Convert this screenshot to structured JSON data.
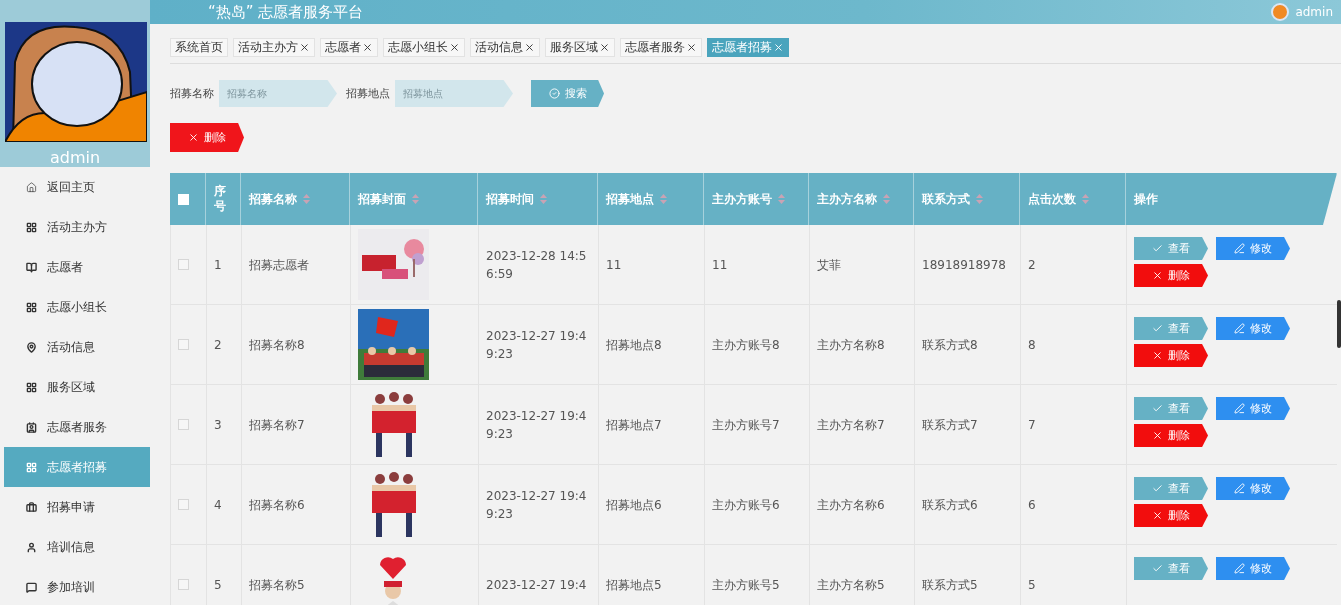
{
  "header": {
    "title": "“热岛” 志愿者服务平台",
    "user": "admin"
  },
  "sidebar": {
    "user": "admin",
    "items": [
      {
        "label": "返回主页",
        "selected": false
      },
      {
        "label": "活动主办方",
        "selected": false
      },
      {
        "label": "志愿者",
        "selected": false
      },
      {
        "label": "志愿小组长",
        "selected": false
      },
      {
        "label": "活动信息",
        "selected": false
      },
      {
        "label": "服务区域",
        "selected": false
      },
      {
        "label": "志愿者服务",
        "selected": false
      },
      {
        "label": "志愿者招募",
        "selected": true
      },
      {
        "label": "招募申请",
        "selected": false
      },
      {
        "label": "培训信息",
        "selected": false
      },
      {
        "label": "参加培训",
        "selected": false
      }
    ]
  },
  "tabs": [
    {
      "label": "系统首页",
      "closable": false,
      "selected": false
    },
    {
      "label": "活动主办方",
      "closable": true,
      "selected": false
    },
    {
      "label": "志愿者",
      "closable": true,
      "selected": false
    },
    {
      "label": "志愿小组长",
      "closable": true,
      "selected": false
    },
    {
      "label": "活动信息",
      "closable": true,
      "selected": false
    },
    {
      "label": "服务区域",
      "closable": true,
      "selected": false
    },
    {
      "label": "志愿者服务",
      "closable": true,
      "selected": false
    },
    {
      "label": "志愿者招募",
      "closable": true,
      "selected": true
    }
  ],
  "search": {
    "fields": [
      {
        "label": "招募名称",
        "placeholder": "招募名称"
      },
      {
        "label": "招募地点",
        "placeholder": "招募地点"
      }
    ],
    "button": "搜索"
  },
  "delete_button": "删除",
  "table": {
    "all_checked": false,
    "columns": [
      {
        "label": "序号",
        "sortable": false
      },
      {
        "label": "招募名称",
        "sortable": true
      },
      {
        "label": "招募封面",
        "sortable": true
      },
      {
        "label": "招募时间",
        "sortable": true
      },
      {
        "label": "招募地点",
        "sortable": true
      },
      {
        "label": "主办方账号",
        "sortable": true
      },
      {
        "label": "主办方名称",
        "sortable": true
      },
      {
        "label": "联系方式",
        "sortable": true
      },
      {
        "label": "点击次数",
        "sortable": true
      },
      {
        "label": "操作",
        "sortable": false
      }
    ],
    "rows": [
      {
        "checked": false,
        "cells": [
          "1",
          "招募志愿者",
          {
            "kind": "picture"
          },
          "2023-12-28 14:56:59",
          "11",
          "11",
          "艾菲",
          "18918918978",
          "2"
        ],
        "actions": [
          {
            "kind": "view",
            "label": "查看"
          },
          {
            "kind": "edit",
            "label": "修改"
          },
          {
            "kind": "delete",
            "label": "删除"
          }
        ]
      },
      {
        "checked": false,
        "cells": [
          "2",
          "招募名称8",
          {
            "kind": "picture"
          },
          "2023-12-27 19:49:23",
          "招募地点8",
          "主办方账号8",
          "主办方名称8",
          "联系方式8",
          "8"
        ],
        "actions": [
          {
            "kind": "view",
            "label": "查看"
          },
          {
            "kind": "edit",
            "label": "修改"
          },
          {
            "kind": "delete",
            "label": "删除"
          }
        ]
      },
      {
        "checked": false,
        "cells": [
          "3",
          "招募名称7",
          {
            "kind": "picture"
          },
          "2023-12-27 19:49:23",
          "招募地点7",
          "主办方账号7",
          "主办方名称7",
          "联系方式7",
          "7"
        ],
        "actions": [
          {
            "kind": "view",
            "label": "查看"
          },
          {
            "kind": "edit",
            "label": "修改"
          },
          {
            "kind": "delete",
            "label": "删除"
          }
        ]
      },
      {
        "checked": false,
        "cells": [
          "4",
          "招募名称6",
          {
            "kind": "picture"
          },
          "2023-12-27 19:49:23",
          "招募地点6",
          "主办方账号6",
          "主办方名称6",
          "联系方式6",
          "6"
        ],
        "actions": [
          {
            "kind": "view",
            "label": "查看"
          },
          {
            "kind": "edit",
            "label": "修改"
          },
          {
            "kind": "delete",
            "label": "删除"
          }
        ]
      },
      {
        "checked": false,
        "cells": [
          "5",
          "招募名称5",
          {
            "kind": "picture"
          },
          "2023-12-27 19:4",
          "招募地点5",
          "主办方账号5",
          "主办方名称5",
          "联系方式5",
          "5"
        ],
        "actions": [
          {
            "kind": "view",
            "label": "查看"
          },
          {
            "kind": "edit",
            "label": "修改"
          }
        ]
      }
    ]
  }
}
